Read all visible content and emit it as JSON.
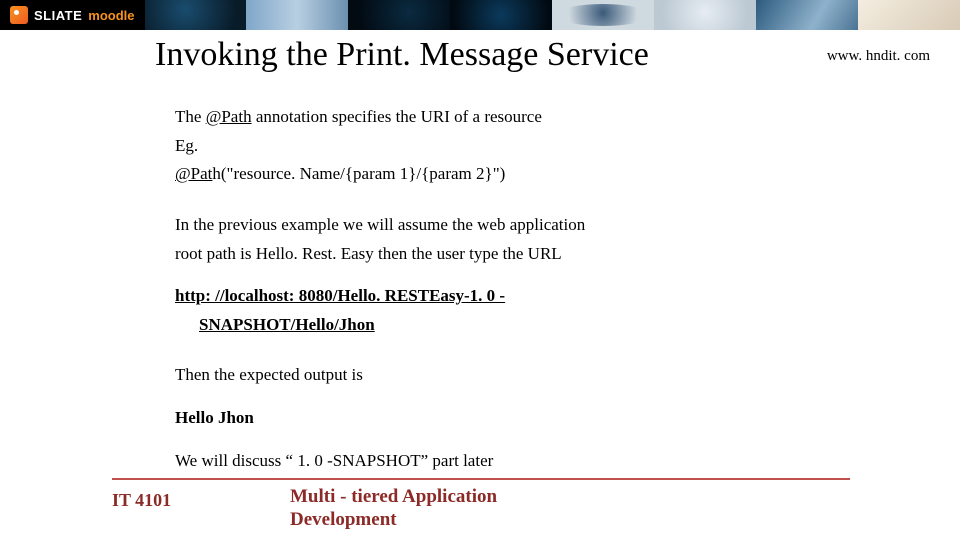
{
  "brand": {
    "part1": "SLIATE",
    "part2": "moodle"
  },
  "title": "Invoking the Print. Message Service",
  "site_url": "www. hndit. com",
  "body": {
    "line1_pre": "The ",
    "line1_anno": "@Path",
    "line1_post": " annotation specifies the URI of a resource",
    "line2": "Eg.",
    "line3_anno": "@Pat",
    "line3_rest": "h(\"resource. Name/{param 1}/{param 2}\")",
    "para2_l1": "In the previous example we will assume the web application",
    "para2_l2": "root path is Hello. Rest. Easy then the user type the URL",
    "link_l1": "http: //localhost: 8080/Hello. RESTEasy-1. 0 -",
    "link_l2": "SNAPSHOT/Hello/Jhon",
    "para3": "Then the expected output is",
    "out": "Hello Jhon",
    "para4": "We will discuss “ 1. 0 -SNAPSHOT” part later"
  },
  "footer": {
    "course_code": "IT 4101",
    "title_l1": "Multi - tiered Application",
    "title_l2": "Development"
  }
}
